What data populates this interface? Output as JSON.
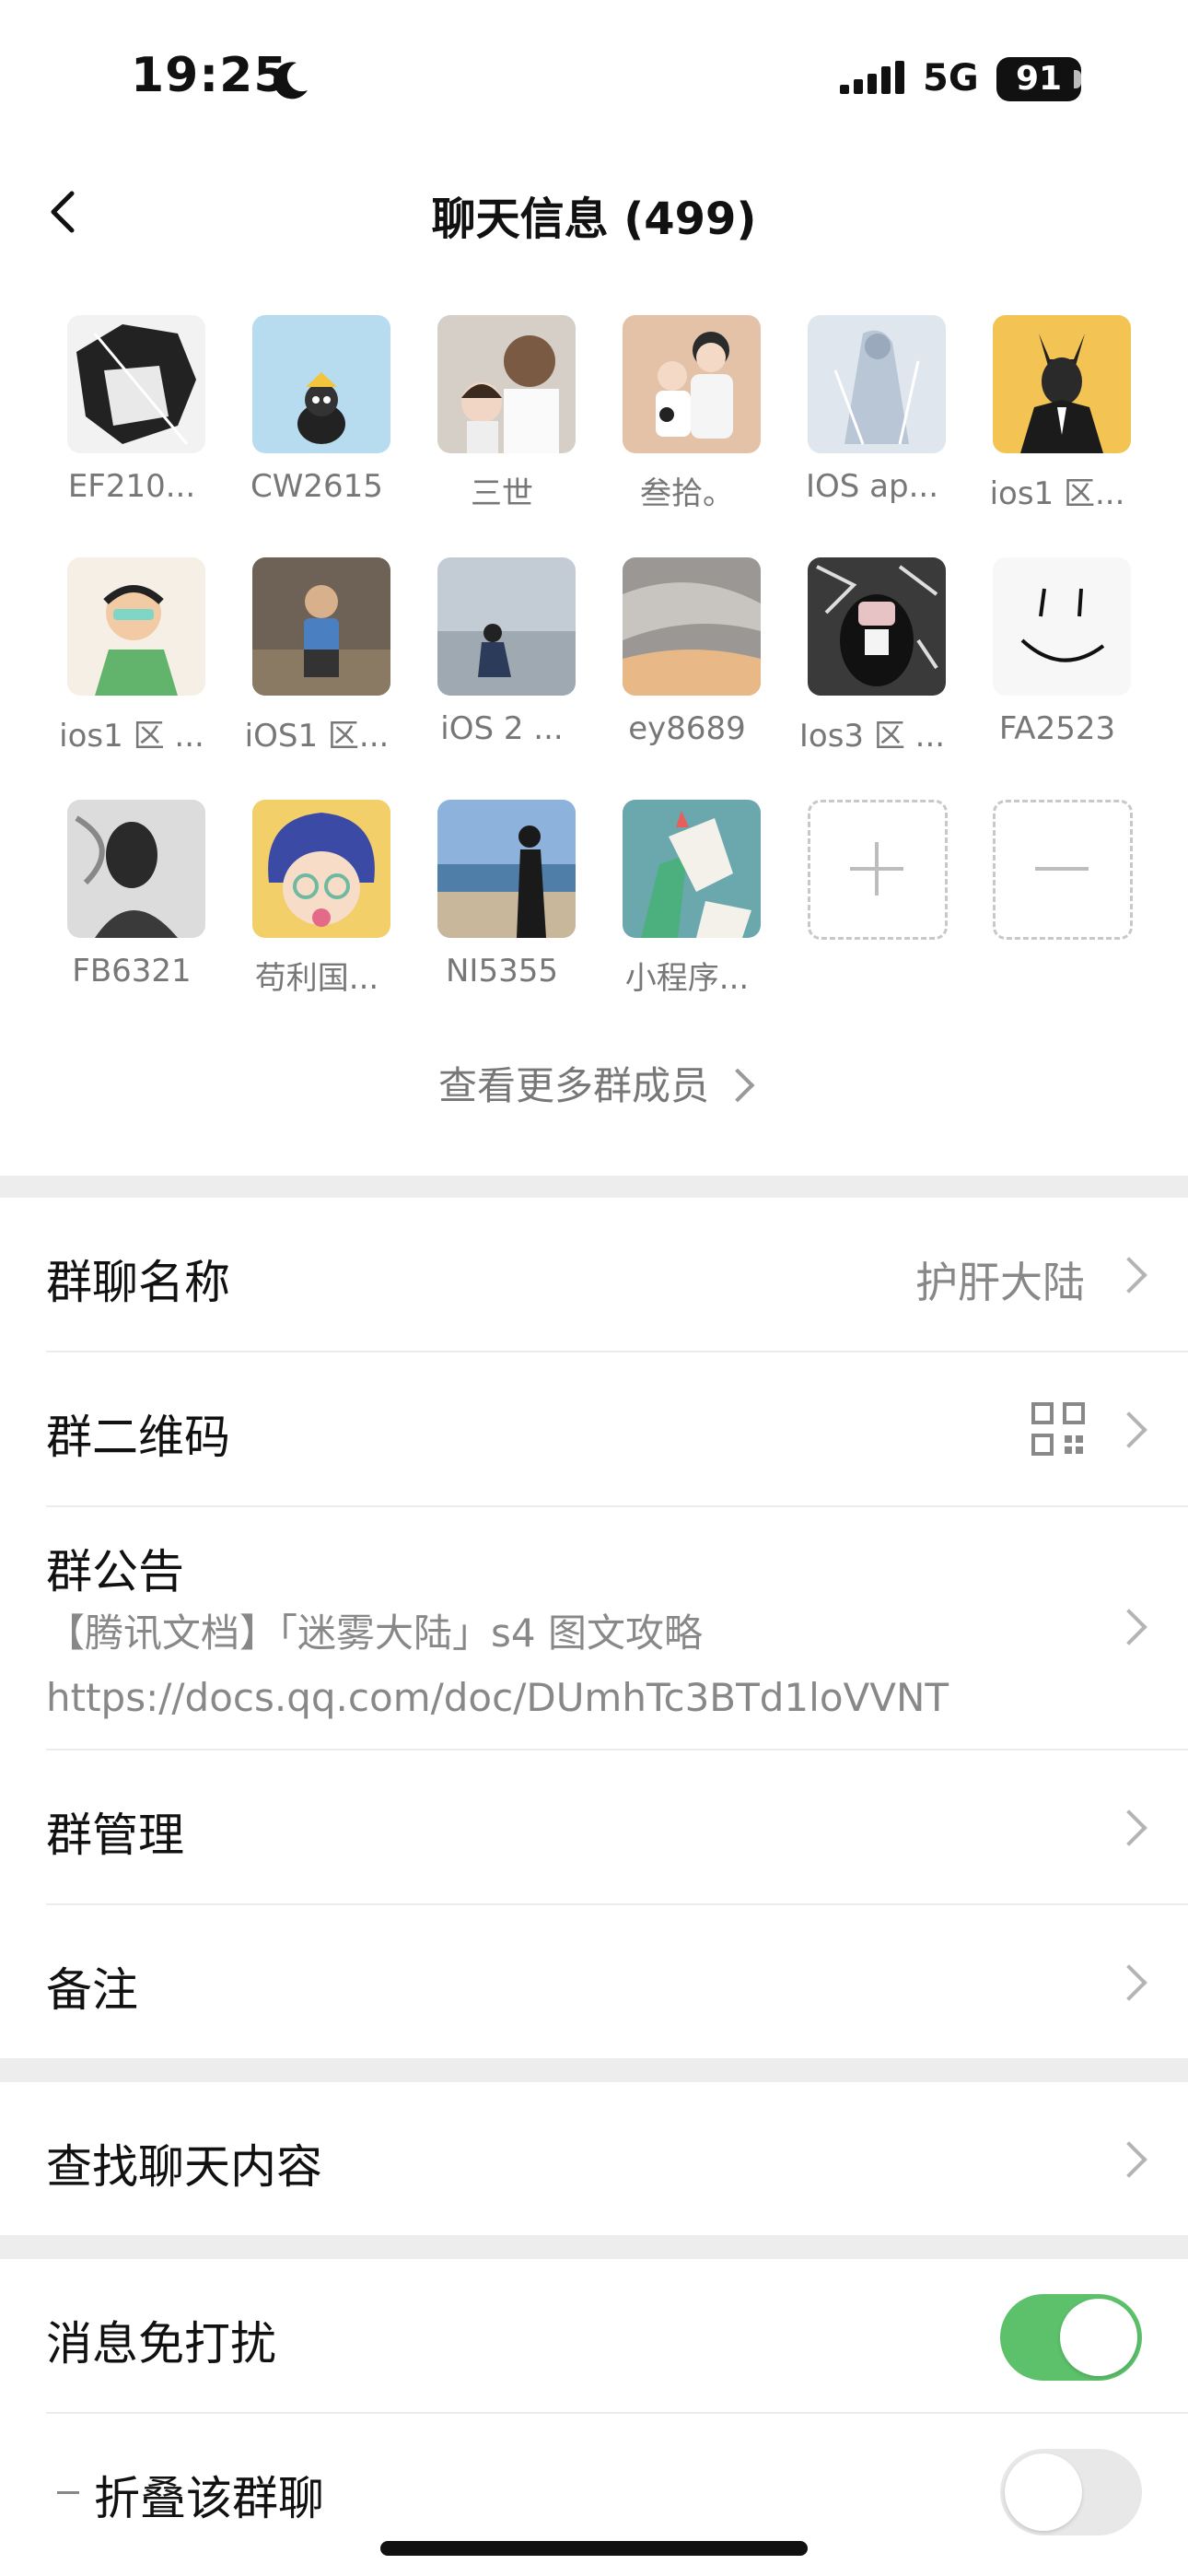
{
  "status_bar": {
    "time": "19:25",
    "network": "5G",
    "battery": "91"
  },
  "header": {
    "title": "聊天信息 (499)"
  },
  "members": [
    {
      "name": "EF210..."
    },
    {
      "name": "CW2615"
    },
    {
      "name": "三世"
    },
    {
      "name": "叁拾。"
    },
    {
      "name": "IOS ap..."
    },
    {
      "name": "ios1 区..."
    },
    {
      "name": "ios1 区 ..."
    },
    {
      "name": "iOS1 区..."
    },
    {
      "name": "iOS 2 ..."
    },
    {
      "name": "ey8689"
    },
    {
      "name": "Ios3 区 ..."
    },
    {
      "name": "FA2523"
    },
    {
      "name": "FB6321"
    },
    {
      "name": "苟利国..."
    },
    {
      "name": "NI5355"
    },
    {
      "name": "小程序..."
    }
  ],
  "see_more": "查看更多群成员",
  "settings": {
    "group_name": {
      "label": "群聊名称",
      "value": "护肝大陆"
    },
    "qr_code": {
      "label": "群二维码"
    },
    "notice": {
      "label": "群公告",
      "line1": "【腾讯文档】「迷雾大陆」s4 图文攻略",
      "line2": "https://docs.qq.com/doc/DUmhTc3BTd1loVVNT"
    },
    "manage": {
      "label": "群管理"
    },
    "remark": {
      "label": "备注"
    },
    "search": {
      "label": "查找聊天内容"
    },
    "mute": {
      "label": "消息免打扰",
      "enabled": true
    },
    "fold": {
      "label": "折叠该群聊",
      "enabled": false
    }
  },
  "colors": {
    "toggle_on": "#5cc16a",
    "gap": "#ededed"
  }
}
